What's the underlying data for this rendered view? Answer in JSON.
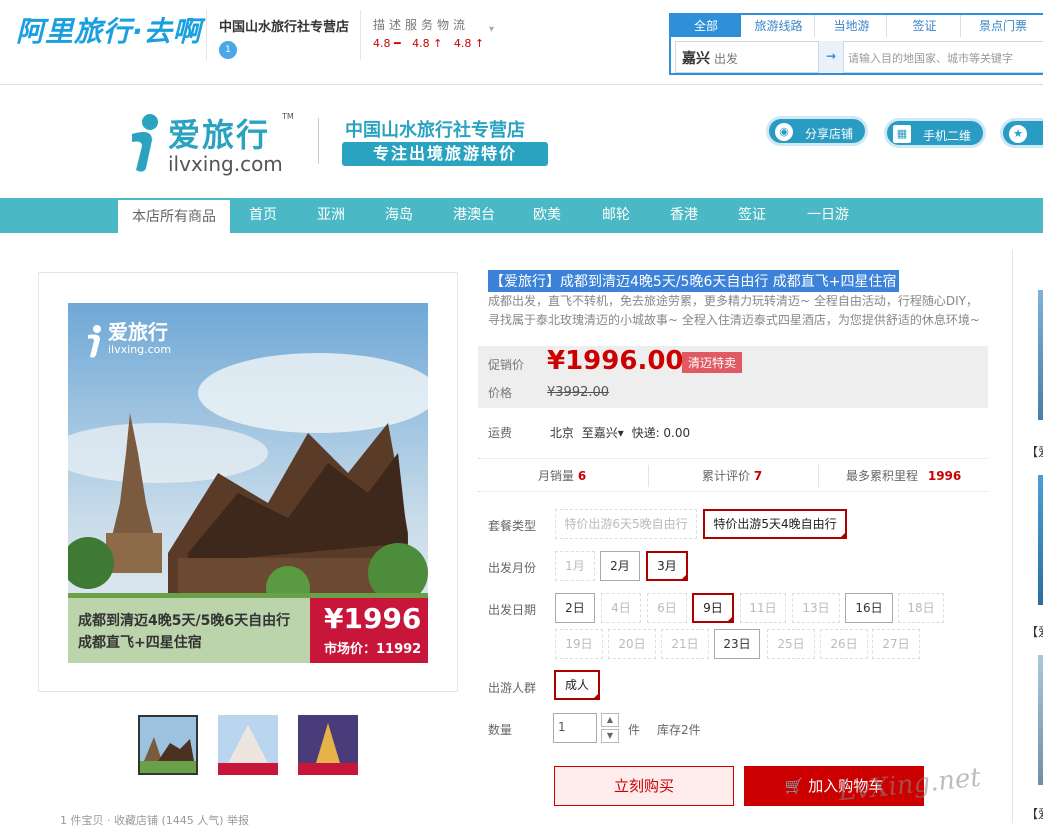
{
  "topbar": {
    "logo": "阿里旅行·去啊",
    "store_name": "中国山水旅行社专营店",
    "badge": "1",
    "rating_labels": "描述服务物流",
    "ratings": [
      "4.8 ━",
      "4.8 ↑",
      "4.8 ↑"
    ]
  },
  "search": {
    "tabs": [
      "全部",
      "旅游线路",
      "当地游",
      "签证",
      "景点门票"
    ],
    "from_city": "嘉兴",
    "from_suffix": "出发",
    "dest_placeholder": "请输入目的地国家、城市等关键字"
  },
  "shop": {
    "brand_cn": "爱旅行",
    "brand_en": "ilvxing.com",
    "brand_tm": "TM",
    "title": "中国山水旅行社专营店",
    "slogan": "专注出境旅游特价",
    "share_btn": "分享店铺",
    "qr_btn": "手机二维码"
  },
  "nav": [
    "本店所有商品",
    "首页",
    "亚洲",
    "海岛",
    "港澳台",
    "欧美",
    "邮轮",
    "香港",
    "签证",
    "一日游"
  ],
  "gallery": {
    "img_brand": "爱旅行",
    "img_brand_en": "ilvxing.com",
    "caption_line1": "成都到清迈4晚5天/5晚6天自由行",
    "caption_line2": "成都直飞+四星住宿",
    "caption_price": "¥1996",
    "caption_market": "市场价：11992"
  },
  "product": {
    "title": "【爱旅行】成都到清迈4晚5天/5晚6天自由行 成都直飞+四星住宿",
    "desc": "成都出发，直飞不转机，免去旅途劳累，更多精力玩转清迈~ 全程自由活动，行程随心DIY，寻找属于泰北玫瑰清迈的小城故事~ 全程入住清迈泰式四星酒店，为您提供舒适的休息环境~",
    "promo_label": "促销价",
    "price_now": "¥1996.00",
    "price_tag": "清迈特卖",
    "price_label": "价格",
    "price_old": "¥3992.00",
    "ship_label": "运费",
    "ship_from": "北京",
    "ship_to": "至嘉兴",
    "ship_value": "快递: 0.00",
    "monthly_sales_label": "月销量",
    "monthly_sales": "6",
    "reviews_label": "累计评价",
    "reviews": "7",
    "mileage_label": "最多累积里程",
    "mileage": "1996"
  },
  "options": {
    "package_label": "套餐类型",
    "packages": [
      "特价出游6天5晚自由行",
      "特价出游5天4晚自由行"
    ],
    "month_label": "出发月份",
    "months": [
      "1月",
      "2月",
      "3月"
    ],
    "date_label": "出发日期",
    "dates_row1": [
      "2日",
      "4日",
      "6日",
      "9日",
      "11日",
      "13日",
      "16日",
      "18日"
    ],
    "dates_row2": [
      "19日",
      "20日",
      "21日",
      "23日",
      "25日",
      "26日",
      "27日"
    ],
    "crowd_label": "出游人群",
    "crowd": "成人",
    "qty_label": "数量",
    "qty_value": "1",
    "qty_unit": "件",
    "stock": "库存2件"
  },
  "actions": {
    "buy_now": "立刻购买",
    "add_cart": "加入购物车",
    "watermark": "LvXing.net"
  },
  "right": {
    "labels": [
      "【爱",
      "【爱",
      "【爱"
    ]
  },
  "bottom": "1 件宝贝 · 收藏店铺 (1445 人气)        举报"
}
